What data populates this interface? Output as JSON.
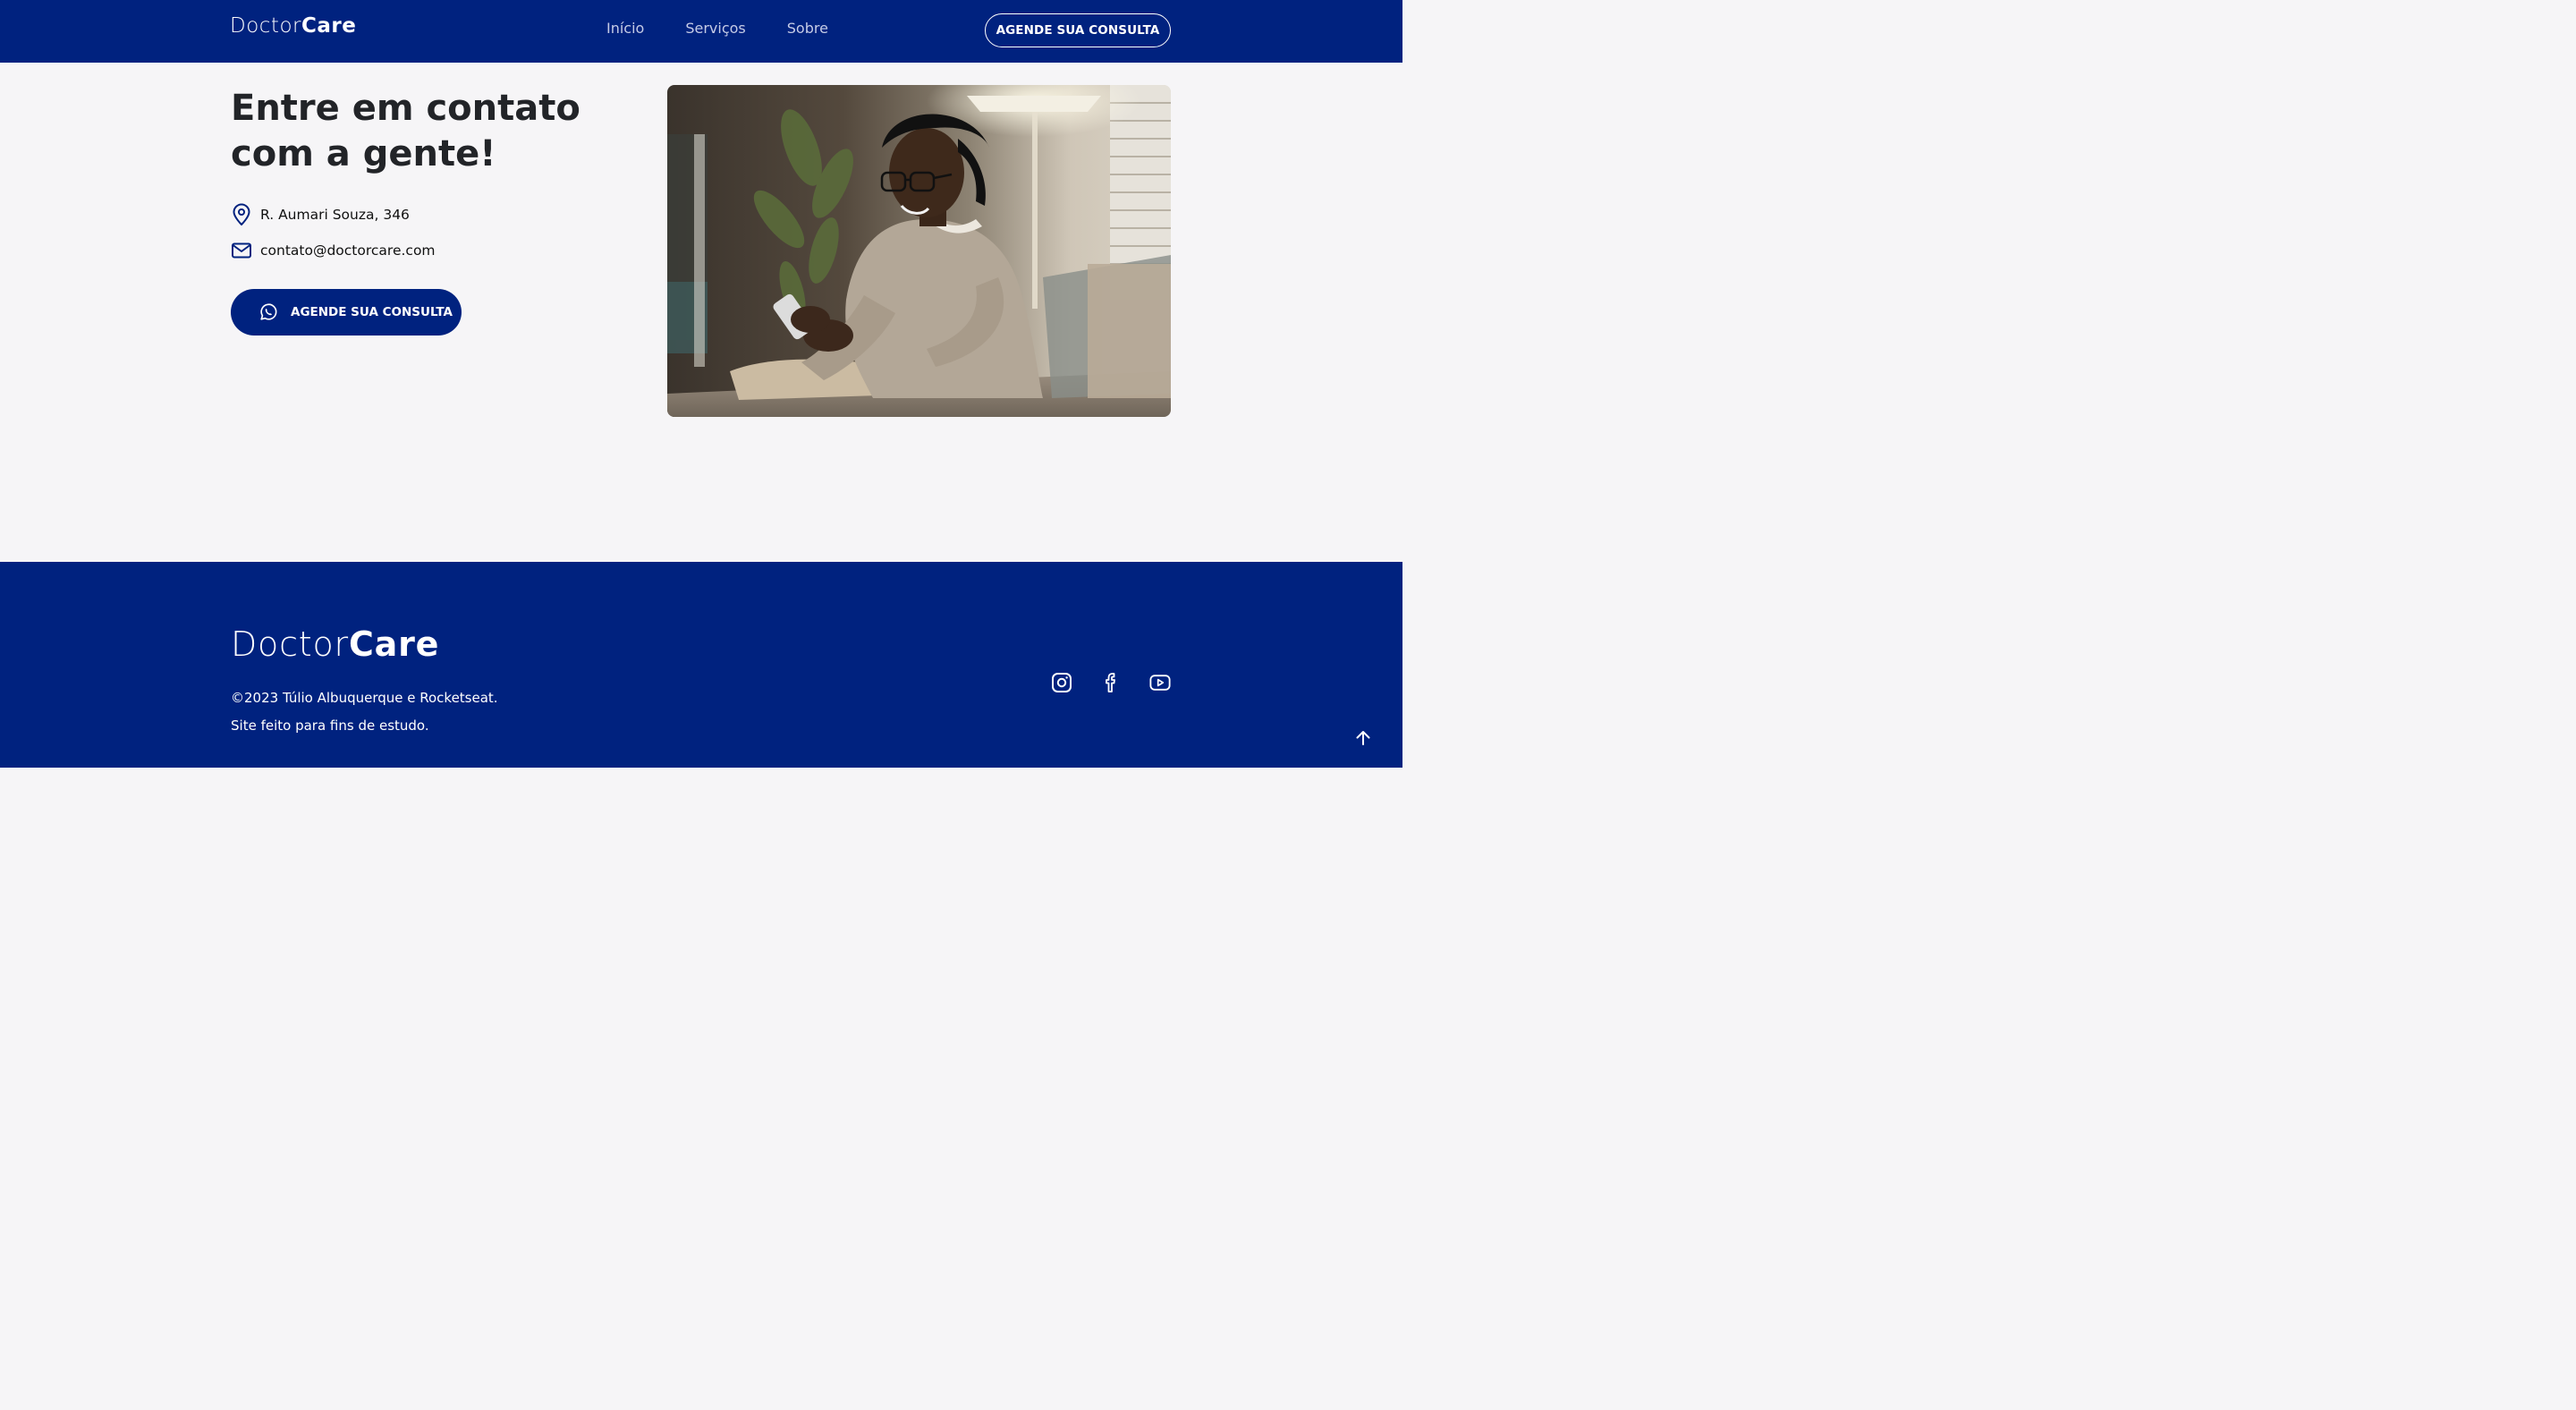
{
  "header": {
    "logo_light": "Doctor",
    "logo_bold": "Care",
    "nav": [
      "Início",
      "Serviços",
      "Sobre"
    ],
    "cta_label": "AGENDE SUA CONSULTA"
  },
  "contact": {
    "title": "Entre em contato com a gente!",
    "address": "R. Aumari Souza, 346",
    "email": "contato@doctorcare.com",
    "cta_label": "AGENDE SUA CONSULTA",
    "cta_icon": "whatsapp-icon"
  },
  "footer": {
    "logo_light": "Doctor",
    "logo_bold": "Care",
    "copyright": "©2023 Túlio Albuquerque e Rocketseat.",
    "note": "Site feito para fins de estudo.",
    "social": [
      "instagram-icon",
      "facebook-icon",
      "youtube-icon"
    ]
  },
  "colors": {
    "primary": "#00227F",
    "background": "#F6F5F7",
    "title": "#222428",
    "nav_text": "#C5CBE6"
  }
}
